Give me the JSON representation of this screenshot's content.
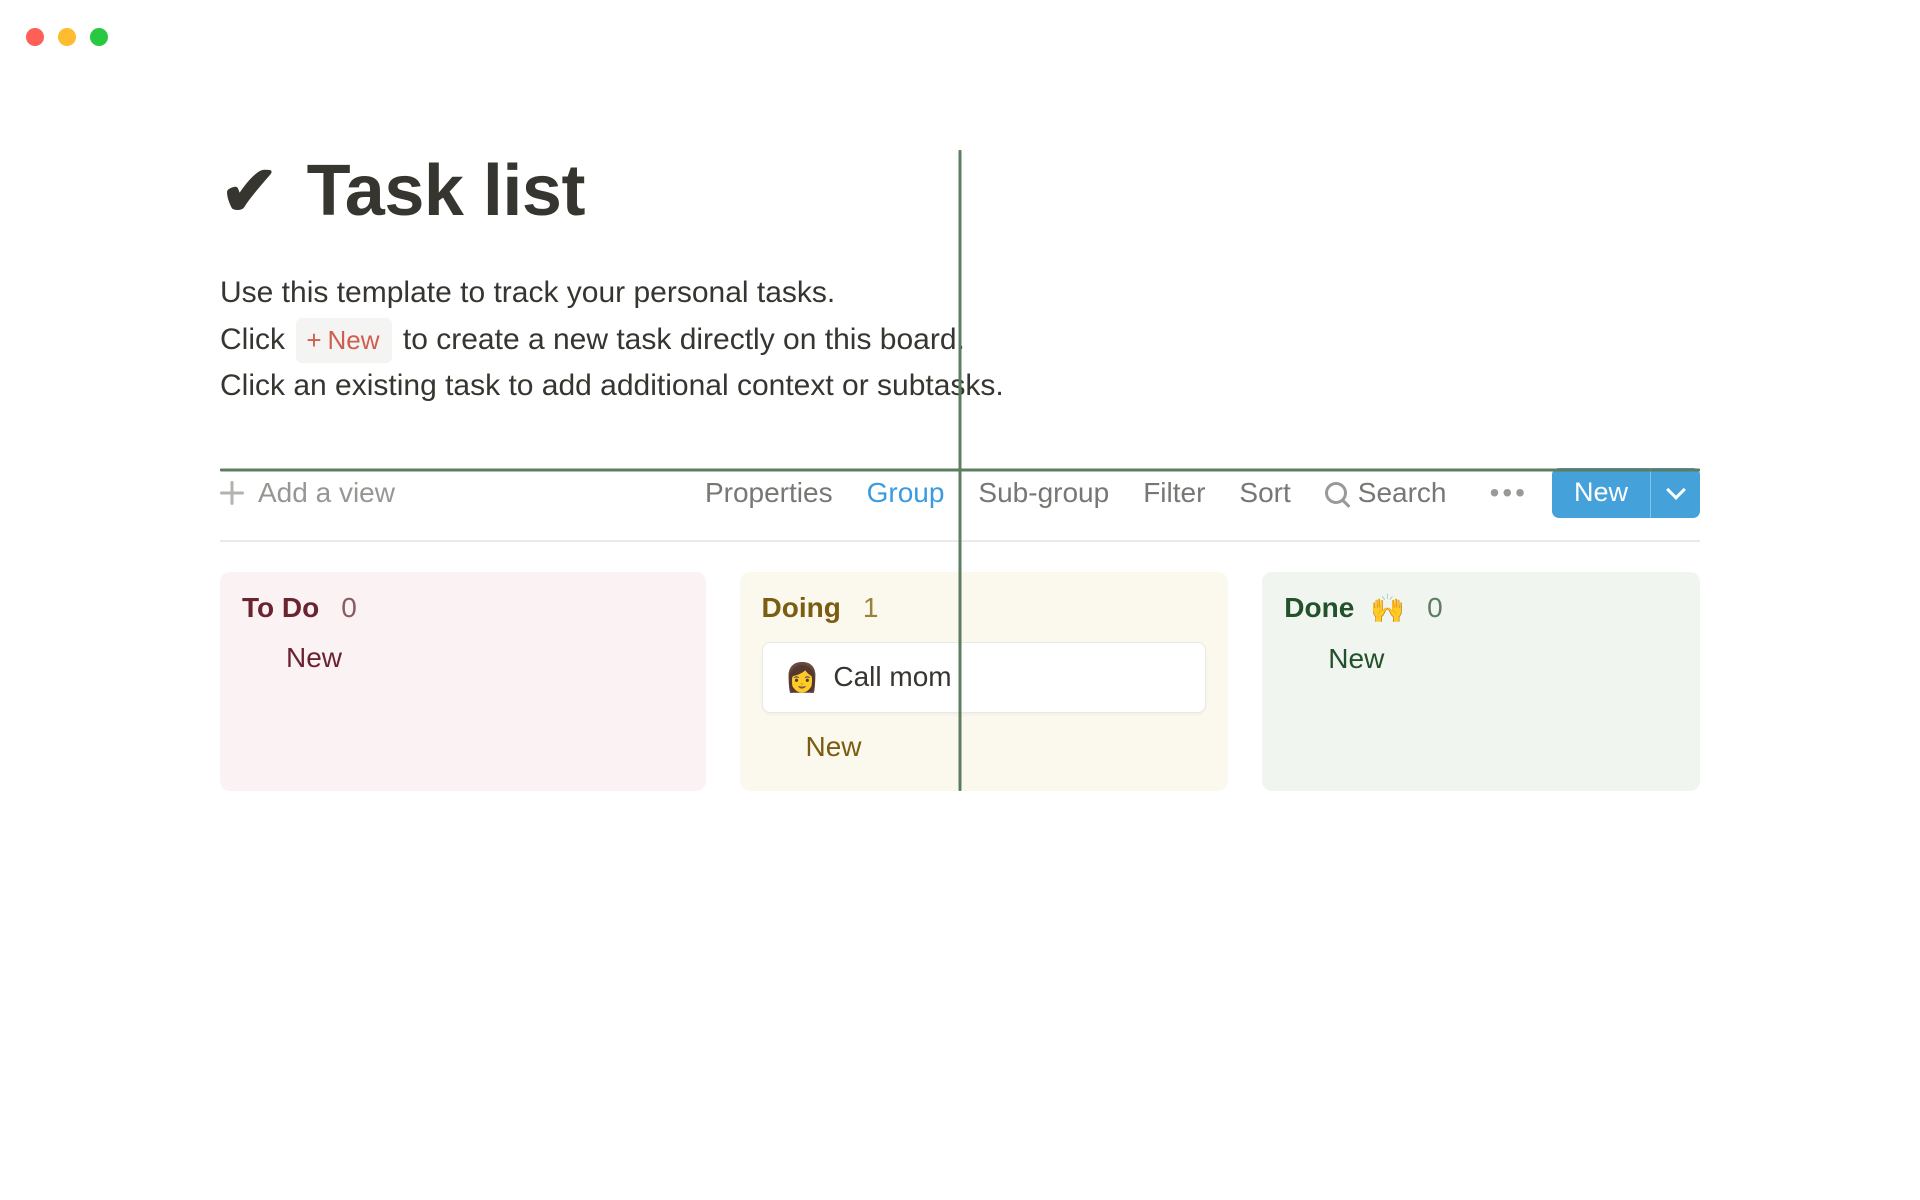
{
  "window": {
    "traffic_colors": {
      "close": "#fe5f57",
      "min": "#febc2e",
      "max": "#28c840"
    }
  },
  "header": {
    "icon": "✔",
    "title": "Task list",
    "desc_line1": "Use this template to track your personal tasks.",
    "desc_line2_pre": "Click ",
    "inline_new_plus": "+",
    "inline_new_text": "New",
    "desc_line2_post": " to create a new task directly on this board.",
    "desc_line3": "Click an existing task to add additional context or subtasks."
  },
  "toolbar": {
    "add_view_label": "Add a view",
    "items": {
      "properties": "Properties",
      "group": "Group",
      "subgroup": "Sub-group",
      "filter": "Filter",
      "sort": "Sort",
      "search": "Search"
    },
    "dots": "•••",
    "new_button": "New"
  },
  "board": {
    "columns": [
      {
        "id": "todo",
        "title": "To Do",
        "emoji": "",
        "count": "0",
        "add_label": "New",
        "cards": []
      },
      {
        "id": "doing",
        "title": "Doing",
        "emoji": "",
        "count": "1",
        "add_label": "New",
        "cards": [
          {
            "icon": "👩",
            "title": "Call mom"
          }
        ]
      },
      {
        "id": "done",
        "title": "Done",
        "emoji": "🙌",
        "count": "0",
        "add_label": "New",
        "cards": []
      }
    ]
  }
}
